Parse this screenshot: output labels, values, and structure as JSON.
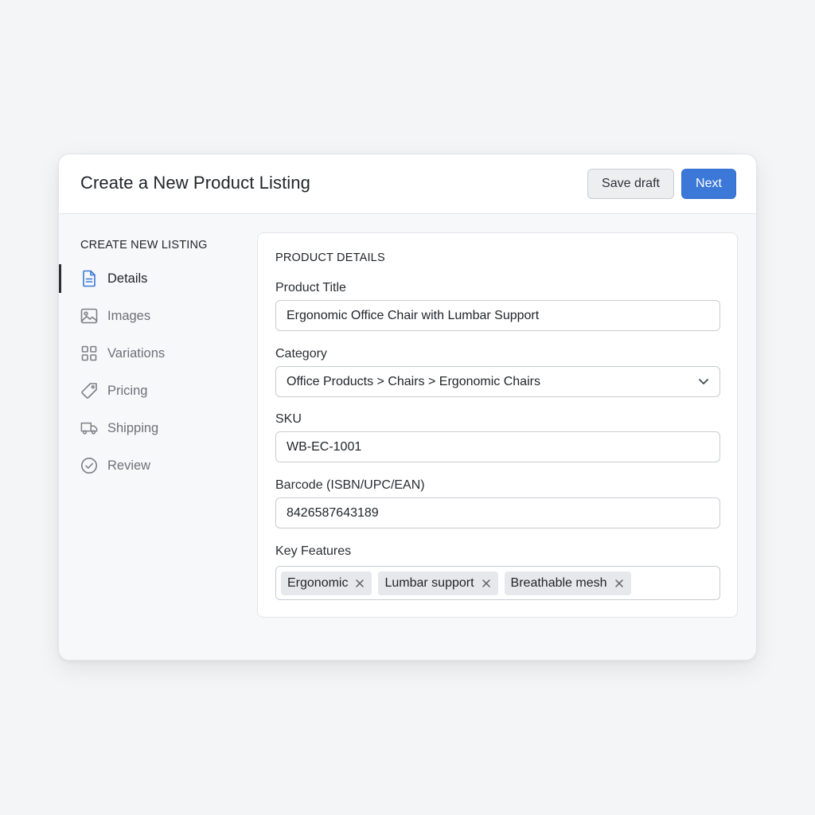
{
  "header": {
    "title": "Create a New Product Listing",
    "save_draft_label": "Save draft",
    "next_label": "Next"
  },
  "sidebar": {
    "heading": "CREATE NEW LISTING",
    "items": [
      {
        "label": "Details",
        "icon": "document-icon",
        "active": true
      },
      {
        "label": "Images",
        "icon": "image-icon",
        "active": false
      },
      {
        "label": "Variations",
        "icon": "grid-icon",
        "active": false
      },
      {
        "label": "Pricing",
        "icon": "tag-icon",
        "active": false
      },
      {
        "label": "Shipping",
        "icon": "truck-icon",
        "active": false
      },
      {
        "label": "Review",
        "icon": "check-circle-icon",
        "active": false
      }
    ]
  },
  "form": {
    "section_title": "PRODUCT DETAILS",
    "product_title": {
      "label": "Product Title",
      "value": "Ergonomic Office Chair with Lumbar Support"
    },
    "category": {
      "label": "Category",
      "value": "Office Products > Chairs > Ergonomic Chairs"
    },
    "sku": {
      "label": "SKU",
      "value": "WB-EC-1001"
    },
    "barcode": {
      "label": "Barcode (ISBN/UPC/EAN)",
      "value": "8426587643189"
    },
    "key_features": {
      "label": "Key Features",
      "tags": [
        "Ergonomic",
        "Lumbar support",
        "Breathable mesh"
      ]
    }
  },
  "colors": {
    "accent": "#3b78d8",
    "active_icon": "#3b78d8",
    "inactive_icon": "#7a8087"
  }
}
